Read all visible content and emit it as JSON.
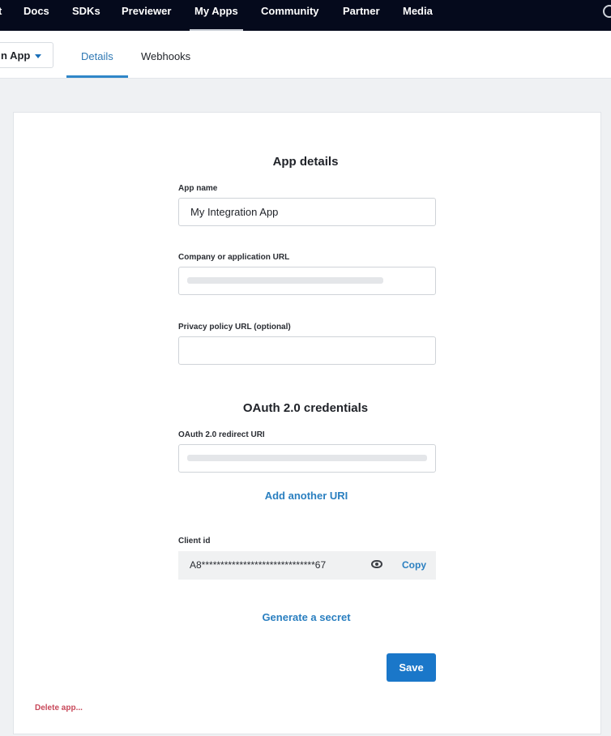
{
  "nav": {
    "items": [
      {
        "label": "t"
      },
      {
        "label": "Docs"
      },
      {
        "label": "SDKs"
      },
      {
        "label": "Previewer"
      },
      {
        "label": "My Apps"
      },
      {
        "label": "Community"
      },
      {
        "label": "Partner"
      },
      {
        "label": "Media"
      }
    ],
    "active": "My Apps",
    "search_icon": "search-icon"
  },
  "subbar": {
    "app_selector": "n App",
    "tabs": [
      {
        "label": "Details",
        "active": true
      },
      {
        "label": "Webhooks",
        "active": false
      }
    ]
  },
  "form": {
    "app_details_title": "App details",
    "app_name_label": "App name",
    "app_name_value": "My Integration App",
    "company_url_label": "Company or application URL",
    "company_url_value": "[redacted]",
    "privacy_url_label": "Privacy policy URL (optional)",
    "privacy_url_value": "",
    "oauth_title": "OAuth 2.0 credentials",
    "redirect_uri_label": "OAuth 2.0 redirect URI",
    "redirect_uri_value": "[redacted]",
    "add_uri_link": "Add another URI",
    "client_id_label": "Client id",
    "client_id_value": "A8******************************67",
    "copy_label": "Copy",
    "generate_secret_link": "Generate a secret",
    "save_label": "Save",
    "delete_label": "Delete app..."
  },
  "colors": {
    "nav_bg": "#050a1c",
    "accent": "#1a77c9",
    "link": "#2a7fc0",
    "danger": "#c8485a"
  }
}
